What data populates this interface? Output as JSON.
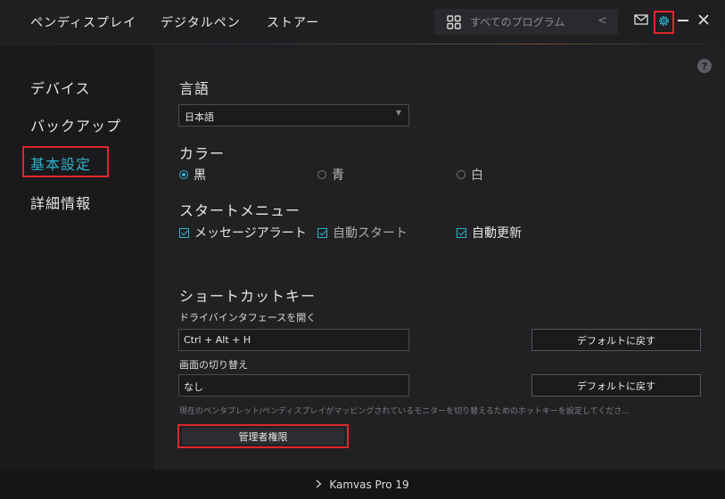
{
  "topbar": {
    "nav": [
      "ペンディスプレイ",
      "デジタルペン",
      "ストアー"
    ],
    "search_label": "すべてのプログラム",
    "search_chevron": "<",
    "icons": [
      "grid-icon",
      "mail-icon",
      "gear-icon",
      "minimize-icon",
      "close-icon"
    ]
  },
  "sidebar": {
    "items": [
      {
        "label": "デバイス",
        "active": false
      },
      {
        "label": "バックアップ",
        "active": false
      },
      {
        "label": "基本設定",
        "active": true
      },
      {
        "label": "詳細情報",
        "active": false
      }
    ]
  },
  "main": {
    "help": "?",
    "language": {
      "heading": "言語",
      "value": "日本語"
    },
    "color": {
      "heading": "カラー",
      "options": [
        {
          "label": "黒",
          "selected": true
        },
        {
          "label": "青",
          "selected": false
        },
        {
          "label": "白",
          "selected": false
        }
      ]
    },
    "start_menu": {
      "heading": "スタートメニュー",
      "options": [
        {
          "label": "メッセージアラート",
          "checked": true
        },
        {
          "label": "自動スタート",
          "checked": true
        },
        {
          "label": "自動更新",
          "checked": true
        }
      ]
    },
    "shortcuts": {
      "heading": "ショートカットキー",
      "open_driver": {
        "label": "ドライバインタフェースを開く",
        "value": "Ctrl + Alt + H",
        "reset_label": "デフォルトに戻す"
      },
      "switch_screen": {
        "label": "画面の切り替え",
        "value": "なし",
        "reset_label": "デフォルトに戻す"
      },
      "hint": "現在のペンタブレット/ペンディスプレイがマッピングされているモニターを切り替えるためのホットキーを設定してくださ..."
    },
    "admin_button": "管理者権限"
  },
  "footer": {
    "device": "Kamvas Pro 19"
  },
  "colors": {
    "accent": "#2bb3cc",
    "highlight": "#e0262b",
    "background": "#212124"
  }
}
